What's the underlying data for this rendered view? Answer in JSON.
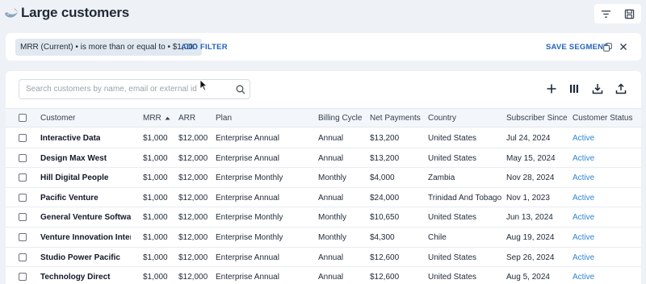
{
  "header": {
    "title": "Large customers",
    "logo_icon": "whale-logo-icon",
    "buttons": [
      "filter-lines-icon",
      "save-disk-icon"
    ]
  },
  "filter_bar": {
    "chip": "MRR (Current) • is more than or equal to • $1,000",
    "add_filter": "ADD FILTER",
    "save_segment": "SAVE SEGMENT",
    "icons": [
      "copy-icon",
      "close-icon"
    ]
  },
  "search": {
    "placeholder": "Search customers by name, email or external id",
    "value": ""
  },
  "toolbar": {
    "icons": [
      "plus-icon",
      "columns-icon",
      "download-icon",
      "upload-icon"
    ]
  },
  "table": {
    "columns": [
      "Customer",
      "MRR",
      "ARR",
      "Plan",
      "Billing Cycle",
      "Net Payments",
      "Country",
      "Subscriber Since",
      "Customer Status"
    ],
    "sorted_column": "MRR",
    "sort_direction": "ascending",
    "rows": [
      [
        "Interactive Data",
        "$1,000",
        "$12,000",
        "Enterprise Annual",
        "Annual",
        "$13,200",
        "United States",
        "Jul 24, 2024",
        "Active"
      ],
      [
        "Design Max West",
        "$1,000",
        "$12,000",
        "Enterprise Annual",
        "Annual",
        "$13,200",
        "United States",
        "May 15, 2024",
        "Active"
      ],
      [
        "Hill Digital People",
        "$1,000",
        "$12,000",
        "Enterprise Monthly",
        "Monthly",
        "$4,000",
        "Zambia",
        "Nov 28, 2024",
        "Active"
      ],
      [
        "Pacific Venture",
        "$1,000",
        "$12,000",
        "Enterprise Annual",
        "Annual",
        "$24,000",
        "Trinidad And Tobago",
        "Nov 1, 2023",
        "Active"
      ],
      [
        "General Venture Software",
        "$1,000",
        "$12,000",
        "Enterprise Monthly",
        "Monthly",
        "$10,650",
        "United States",
        "Jun 13, 2024",
        "Active"
      ],
      [
        "Venture Innovation Inter...",
        "$1,000",
        "$12,000",
        "Enterprise Monthly",
        "Monthly",
        "$4,300",
        "Chile",
        "Aug 19, 2024",
        "Active"
      ],
      [
        "Studio Power Pacific",
        "$1,000",
        "$12,000",
        "Enterprise Annual",
        "Annual",
        "$12,600",
        "United States",
        "Sep 26, 2024",
        "Active"
      ],
      [
        "Technology Direct",
        "$1,000",
        "$12,000",
        "Enterprise Annual",
        "Annual",
        "$12,600",
        "United States",
        "Aug 5, 2024",
        "Active"
      ]
    ]
  },
  "colors": {
    "background": "#eef2f7",
    "link_blue": "#2563b8",
    "status_active": "#2f86d6"
  }
}
